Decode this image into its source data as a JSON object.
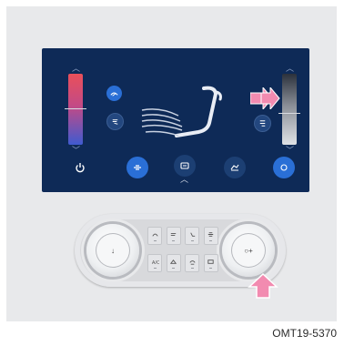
{
  "figure": {
    "caption": "OMT19-5370"
  },
  "display": {
    "left_temp_control": {
      "icon": "temperature-bar-warm-cold"
    },
    "right_temp_control": {
      "icon": "temperature-bar-grayscale"
    },
    "left_buttons": [
      {
        "name": "airflow-windshield",
        "icon": "windshield-airflow-icon"
      },
      {
        "name": "airflow-face",
        "icon": "face-airflow-icon"
      }
    ],
    "right_buttons": [
      {
        "name": "airflow-rear",
        "icon": "rear-airflow-icon"
      }
    ],
    "bottom_controls": [
      {
        "name": "power",
        "icon": "power-icon"
      },
      {
        "name": "ac",
        "icon": "ac-icon"
      },
      {
        "name": "fan",
        "icon": "fan-icon"
      },
      {
        "name": "recirculation",
        "icon": "recirculation-icon"
      },
      {
        "name": "sync",
        "icon": "sync-icon"
      }
    ],
    "highlight_color": "#f28bb0"
  },
  "panel": {
    "left_knob_label": "↓",
    "right_knob_label": "○+"
  }
}
